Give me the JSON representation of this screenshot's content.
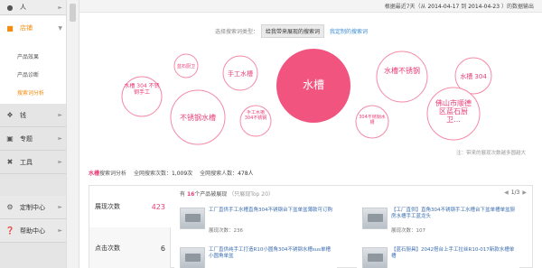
{
  "sidebar": {
    "top": {
      "label": "人",
      "icon": "user-icon"
    },
    "shop": {
      "label": "店铺",
      "icon": "shop-icon"
    },
    "sub_items": [
      {
        "label": "产品效果",
        "active": false
      },
      {
        "label": "产品诊断",
        "active": false
      },
      {
        "label": "搜索词分析",
        "active": true
      }
    ],
    "groups": [
      {
        "label": "钱",
        "icon": "money-icon"
      },
      {
        "label": "专题",
        "icon": "topic-icon"
      },
      {
        "label": "工具",
        "icon": "tool-icon"
      },
      {
        "label": "定制中心",
        "icon": "gear-icon"
      },
      {
        "label": "帮助中心",
        "icon": "help-icon"
      }
    ]
  },
  "header": {
    "date_prefix": "根据最近7天（从",
    "date_from": "2014-04-17",
    "date_mid": "到",
    "date_to": "2014-04-23",
    "date_suffix": "）的数据输出"
  },
  "search_type": {
    "label": "选择搜索词类型：",
    "tab_active": "给我带来展现的搜索词",
    "tab_other": "我定制的搜索词"
  },
  "bubbles": [
    {
      "label": "水槽",
      "value": 1009,
      "main": true
    },
    {
      "label": "手工水槽"
    },
    {
      "label": "蓝石厨卫"
    },
    {
      "label": "水槽 304 不锈钢手工"
    },
    {
      "label": "不锈钢水槽"
    },
    {
      "label": "手工水槽 304不锈钢"
    },
    {
      "label": "304不锈钢水槽"
    },
    {
      "label": "水槽不锈钢"
    },
    {
      "label": "水槽 304"
    },
    {
      "label": "佛山市顺德区蓝石厨卫..."
    }
  ],
  "bubble_note": "注：带来的展现次数越多圆越大",
  "stats": {
    "keyword": "水槽",
    "title_suffix": "搜索词分析",
    "total_search_label": "全网搜索次数：",
    "total_search": "1,009次",
    "total_people_label": "全网搜索人数：",
    "total_people": "478人"
  },
  "left_stats": [
    {
      "label": "展现次数",
      "value": "423",
      "active": true
    },
    {
      "label": "点击次数",
      "value": "6",
      "active": false
    }
  ],
  "products": {
    "prefix": "有",
    "count": "16",
    "suffix": "个产品被展现",
    "hint": "（只展现Top 20）",
    "page": "1/3",
    "items": [
      {
        "title": "工厂直供手工水槽直角304不锈钢台下盆单盆薄款可订购",
        "views": "展现次数：236"
      },
      {
        "title": "【工厂直供】直角304不锈钢手工水槽台下盆单槽单盆厨房水槽手工蓝龙头",
        "views": "展现次数：107"
      },
      {
        "title": "工厂直供纯手工打造R10小圆角304不锈钢水槽sus单槽小圆角单盆",
        "views": ""
      },
      {
        "title": "【蓝石厨具】2042搭台上手工拉丝R10-017新款水槽单槽",
        "views": ""
      }
    ]
  },
  "colors": {
    "accent": "#f08e14",
    "pink": "#e8407a",
    "main_bubble": "#f0547f",
    "link": "#3a8cd0"
  }
}
